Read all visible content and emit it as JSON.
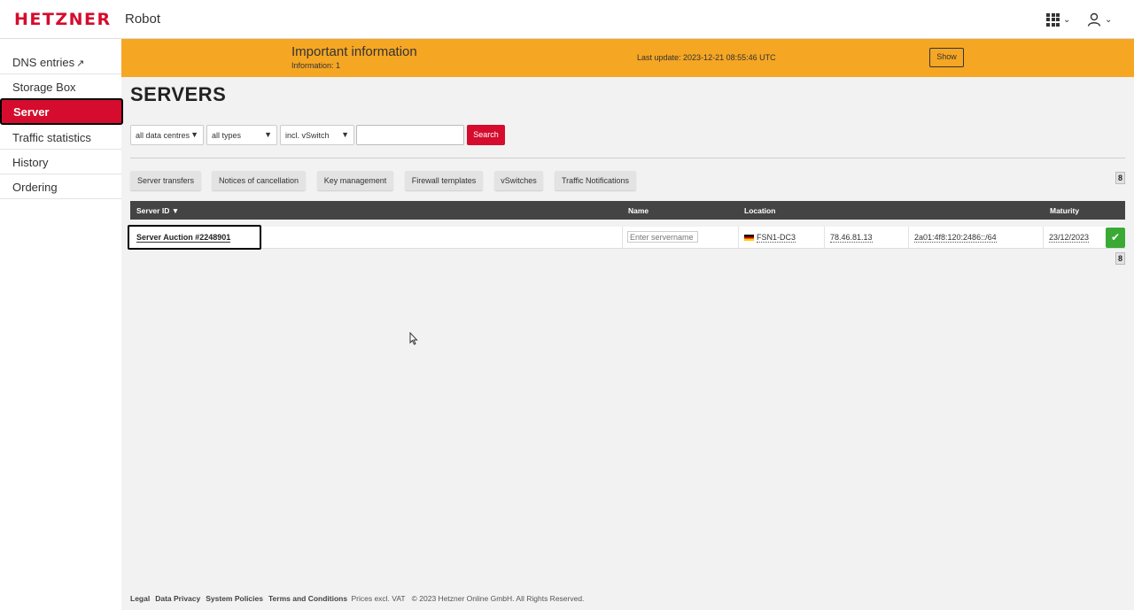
{
  "header": {
    "logo": "HETZNER",
    "app_name": "Robot"
  },
  "sidebar": {
    "items": [
      {
        "label": "DNS entries"
      },
      {
        "label": "Storage Box"
      },
      {
        "label": "Server"
      },
      {
        "label": "Traffic statistics"
      },
      {
        "label": "History"
      },
      {
        "label": "Ordering"
      }
    ]
  },
  "banner": {
    "title": "Important information",
    "subtitle": "Information: 1",
    "last_update": "Last update: 2023-12-21 08:55:46 UTC",
    "show_label": "Show",
    "color": "#f5a623"
  },
  "page": {
    "title": "SERVERS"
  },
  "filters": {
    "data_centre": "all data centres",
    "type": "all types",
    "vswitch": "incl. vSwitch",
    "search_value": "",
    "search_label": "Search"
  },
  "actions": [
    {
      "label": "Server transfers"
    },
    {
      "label": "Notices of cancellation"
    },
    {
      "label": "Key management"
    },
    {
      "label": "Firewall templates"
    },
    {
      "label": "vSwitches"
    },
    {
      "label": "Traffic Notifications"
    }
  ],
  "count_top": "8",
  "count_bottom": "8",
  "table": {
    "headers": {
      "server_id": "Server ID",
      "name": "Name",
      "location": "Location",
      "maturity": "Maturity"
    },
    "rows": [
      {
        "server": "Server Auction #2248901",
        "name_placeholder": "Enter servername",
        "location": "FSN1-DC3",
        "ipv4": "78.46.81.13",
        "ipv6": "2a01:4f8:120:2486::/64",
        "maturity": "23/12/2023"
      }
    ]
  },
  "footer": {
    "legal": "Legal",
    "privacy": "Data Privacy",
    "policies": "System Policies",
    "terms": "Terms and Conditions",
    "prices": "Prices excl. VAT",
    "copyright": "© 2023 Hetzner Online GmbH. All Rights Reserved."
  },
  "colors": {
    "brand_red": "#d50c2d",
    "ok_green": "#3aaa35",
    "table_header": "#444444"
  }
}
